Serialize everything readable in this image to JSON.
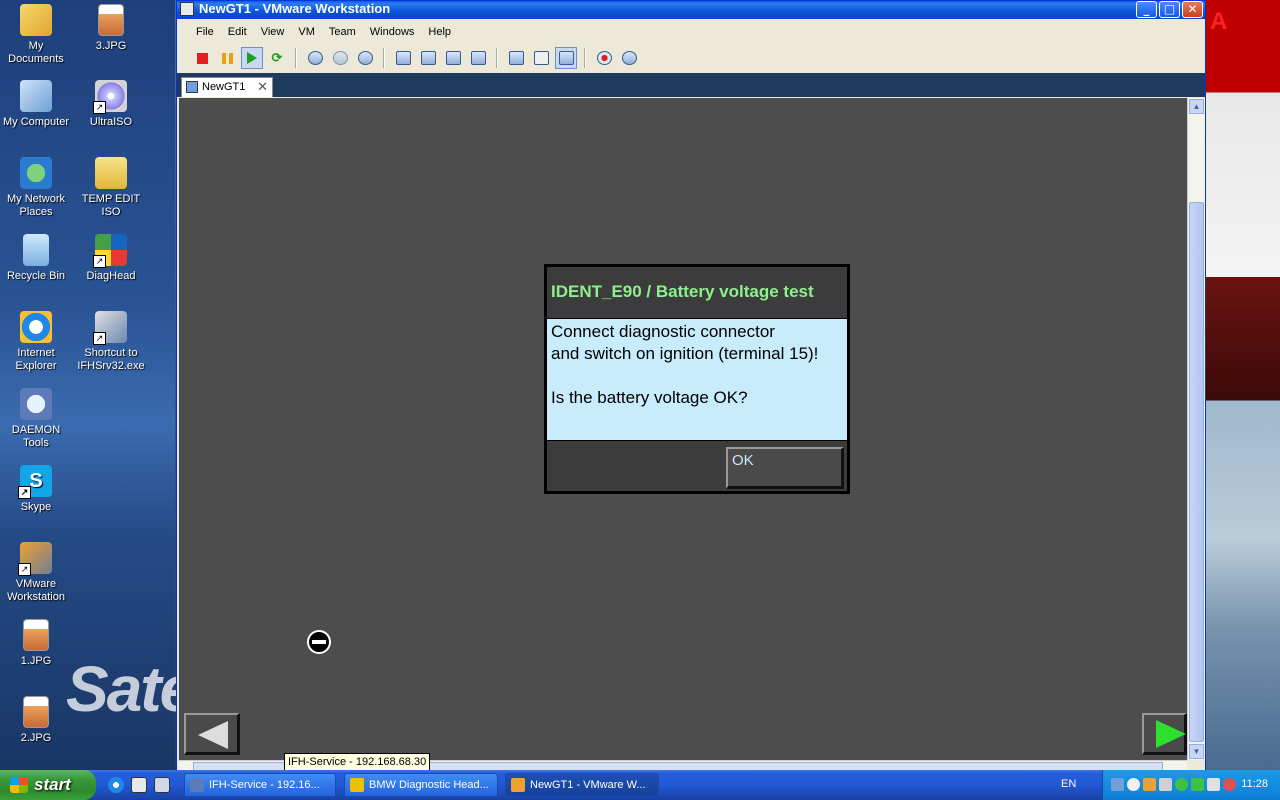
{
  "desktop": {
    "icons": [
      {
        "label": "My Documents",
        "icon": "folder-documents-icon"
      },
      {
        "label": "3.JPG",
        "icon": "jpg-file-icon"
      },
      {
        "label": "My Computer",
        "icon": "computer-icon"
      },
      {
        "label": "UltraISO",
        "icon": "disc-icon"
      },
      {
        "label": "My Network Places",
        "icon": "network-icon"
      },
      {
        "label": "TEMP EDIT ISO",
        "icon": "folder-icon"
      },
      {
        "label": "Recycle Bin",
        "icon": "recycle-bin-icon"
      },
      {
        "label": "DiagHead",
        "icon": "diaghead-icon"
      },
      {
        "label": "Internet Explorer",
        "icon": "internet-explorer-icon"
      },
      {
        "label": "Shortcut to IFHSrv32.exe",
        "icon": "exe-icon"
      },
      {
        "label": "DAEMON Tools",
        "icon": "daemon-tools-icon"
      },
      {
        "label": "Skype",
        "icon": "skype-icon"
      },
      {
        "label": "VMware Workstation",
        "icon": "vmware-icon"
      },
      {
        "label": "1.JPG",
        "icon": "jpg-file-icon"
      },
      {
        "label": "2.JPG",
        "icon": "jpg-file-icon"
      }
    ],
    "wallpaper_text": "Sate",
    "wallpaper_right_text": "A"
  },
  "window": {
    "title": "NewGT1 - VMware Workstation",
    "menu": [
      "File",
      "Edit",
      "View",
      "VM",
      "Team",
      "Windows",
      "Help"
    ],
    "tab_label": "NewGT1",
    "tab_close": "✕"
  },
  "guest": {
    "dialog_title": "IDENT_E90 / Battery voltage test",
    "dialog_body": "Connect diagnostic connector\nand switch on ignition (terminal 15)!\n\nIs the battery voltage OK?",
    "ok_label": "OK"
  },
  "tooltip": "IFH-Service - 192.168.68.30",
  "taskbar": {
    "start_label": "start",
    "tasks": [
      {
        "label": "IFH-Service - 192.16...",
        "icon": "ifh-service-icon"
      },
      {
        "label": "BMW Diagnostic Head...",
        "icon": "bmw-diagnostic-icon"
      },
      {
        "label": "NewGT1 - VMware W...",
        "icon": "vmware-icon"
      }
    ],
    "language": "EN",
    "clock": "11:28"
  }
}
